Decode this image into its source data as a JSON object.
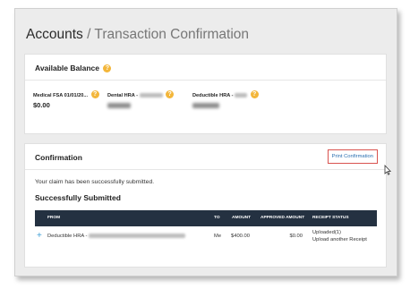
{
  "header": {
    "title_main": "Accounts",
    "separator": "/",
    "title_sub": "Transaction Confirmation"
  },
  "balance": {
    "title": "Available Balance",
    "accounts": [
      {
        "label": "Medical FSA 01/01/20...",
        "amount": "$0.00"
      },
      {
        "label": "Dental HRA - ",
        "amount": ""
      },
      {
        "label": "Deductible HRA - ",
        "amount": ""
      }
    ]
  },
  "confirmation": {
    "title": "Confirmation",
    "print_label": "Print Confirmation",
    "message": "Your claim has been successfully submitted.",
    "subtitle": "Successfully Submitted",
    "columns": [
      "FROM",
      "TO",
      "AMOUNT",
      "APPROVED AMOUNT",
      "RECEIPT STATUS"
    ],
    "rows": [
      {
        "from": "Deductible HRA - ",
        "to": "Me",
        "amount": "$400.00",
        "approved": "$0.00",
        "receipt_status": "Uploaded(1)",
        "receipt_action": "Upload another Receipt"
      }
    ]
  },
  "colors": {
    "accent": "#2a6fb0",
    "header_bg": "#243141",
    "help_icon": "#f3b63a",
    "highlight": "#d9534f"
  },
  "icons": {
    "help": "question-circle-icon",
    "expand": "plus-icon",
    "cursor": "mouse-pointer-icon"
  }
}
